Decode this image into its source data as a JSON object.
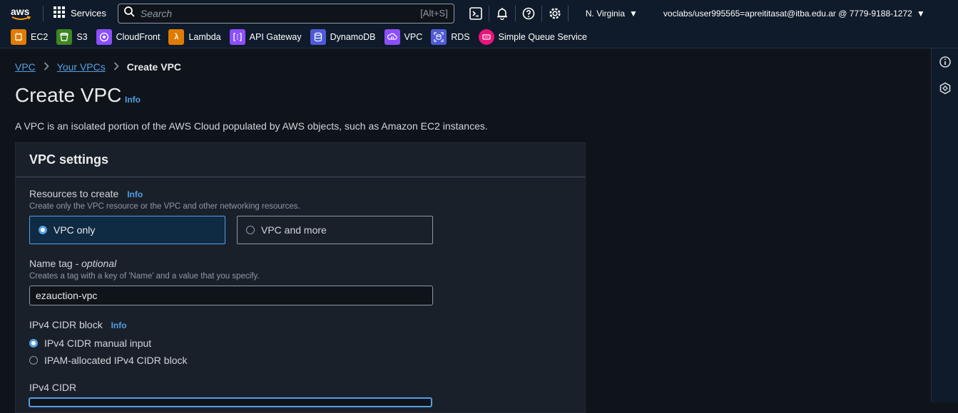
{
  "topnav": {
    "services_label": "Services",
    "search_placeholder": "Search",
    "search_shortcut": "[Alt+S]",
    "region": "N. Virginia",
    "account": "voclabs/user995565=apreititasat@itba.edu.ar @ 7779-9188-1272"
  },
  "favorites": [
    {
      "label": "EC2",
      "color": "#e07b00"
    },
    {
      "label": "S3",
      "color": "#3f8624"
    },
    {
      "label": "CloudFront",
      "color": "#8c4fff"
    },
    {
      "label": "Lambda",
      "color": "#e07b00"
    },
    {
      "label": "API Gateway",
      "color": "#8c4fff"
    },
    {
      "label": "DynamoDB",
      "color": "#4f5bd5"
    },
    {
      "label": "VPC",
      "color": "#8c4fff"
    },
    {
      "label": "RDS",
      "color": "#4f5bd5"
    },
    {
      "label": "Simple Queue Service",
      "color": "#e7157b"
    }
  ],
  "breadcrumb": {
    "item1": "VPC",
    "item2": "Your VPCs",
    "current": "Create VPC"
  },
  "page": {
    "title": "Create VPC",
    "info": "Info",
    "description": "A VPC is an isolated portion of the AWS Cloud populated by AWS objects, such as Amazon EC2 instances."
  },
  "settings": {
    "header": "VPC settings",
    "resources_label": "Resources to create",
    "resources_info": "Info",
    "resources_hint": "Create only the VPC resource or the VPC and other networking resources.",
    "option_vpc_only": "VPC only",
    "option_vpc_more": "VPC and more",
    "name_label": "Name tag - ",
    "name_optional": "optional",
    "name_hint": "Creates a tag with a key of 'Name' and a value that you specify.",
    "name_value": "ezauction-vpc",
    "cidr_block_label": "IPv4 CIDR block",
    "cidr_block_info": "Info",
    "cidr_manual": "IPv4 CIDR manual input",
    "cidr_ipam": "IPAM-allocated IPv4 CIDR block",
    "cidr_label": "IPv4 CIDR"
  },
  "colors": {
    "accent": "#539fe5",
    "nav_bg": "#0f1b2a",
    "panel_bg": "#1a2029"
  }
}
